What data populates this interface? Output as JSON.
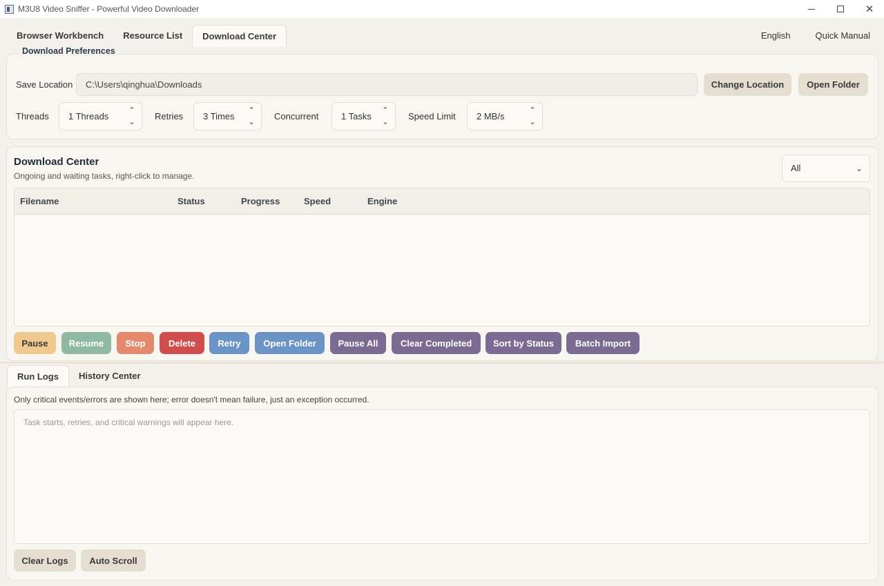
{
  "window": {
    "title": "M3U8 Video Sniffer - Powerful Video Downloader",
    "controls": {
      "minimize": "minimize",
      "maximize": "maximize",
      "close": "✕"
    }
  },
  "top_tabs": [
    {
      "label": "Browser Workbench",
      "active": false
    },
    {
      "label": "Resource List",
      "active": false
    },
    {
      "label": "Download Center",
      "active": true
    }
  ],
  "top_right": {
    "language": "English",
    "manual": "Quick Manual"
  },
  "preferences": {
    "legend": "Download Preferences",
    "save_location_label": "Save Location",
    "save_location_value": "C:\\Users\\qinghua\\Downloads",
    "change_location_button": "Change Location",
    "open_folder_button": "Open Folder",
    "threads_label": "Threads",
    "threads_value": "1 Threads",
    "retries_label": "Retries",
    "retries_value": "3 Times",
    "concurrent_label": "Concurrent",
    "concurrent_value": "1 Tasks",
    "speed_limit_label": "Speed Limit",
    "speed_limit_value": "2 MB/s"
  },
  "download_center": {
    "title": "Download Center",
    "subtitle": "Ongoing and waiting tasks, right-click to manage.",
    "filter_value": "All",
    "columns": [
      "Filename",
      "Status",
      "Progress",
      "Speed",
      "Engine"
    ],
    "rows": [],
    "actions": [
      {
        "label": "Pause",
        "color": "#f0c98e",
        "text_color": "#3a3a3a"
      },
      {
        "label": "Resume",
        "color": "#8fb9a3",
        "text_color": "#ffffff"
      },
      {
        "label": "Stop",
        "color": "#e38a6c",
        "text_color": "#ffffff"
      },
      {
        "label": "Delete",
        "color": "#cf4d4d",
        "text_color": "#ffffff"
      },
      {
        "label": "Retry",
        "color": "#6b93c6",
        "text_color": "#ffffff"
      },
      {
        "label": "Open Folder",
        "color": "#6b93c6",
        "text_color": "#ffffff"
      },
      {
        "label": "Pause All",
        "color": "#7b6b93",
        "text_color": "#ffffff"
      },
      {
        "label": "Clear Completed",
        "color": "#7b6b93",
        "text_color": "#ffffff"
      },
      {
        "label": "Sort by Status",
        "color": "#7b6b93",
        "text_color": "#ffffff"
      },
      {
        "label": "Batch Import",
        "color": "#7b6b93",
        "text_color": "#ffffff"
      }
    ]
  },
  "logs": {
    "tabs": [
      {
        "label": "Run Logs",
        "active": true
      },
      {
        "label": "History Center",
        "active": false
      }
    ],
    "note": "Only critical events/errors are shown here; error doesn't mean failure, just an exception occurred.",
    "placeholder": "Task starts, retries, and critical warnings will appear here.",
    "clear_button": "Clear Logs",
    "auto_scroll_button": "Auto Scroll"
  },
  "colors": {
    "background": "#f3f1ec",
    "tan_button": "#e6ddd1",
    "panel": "#f8f6f1"
  }
}
